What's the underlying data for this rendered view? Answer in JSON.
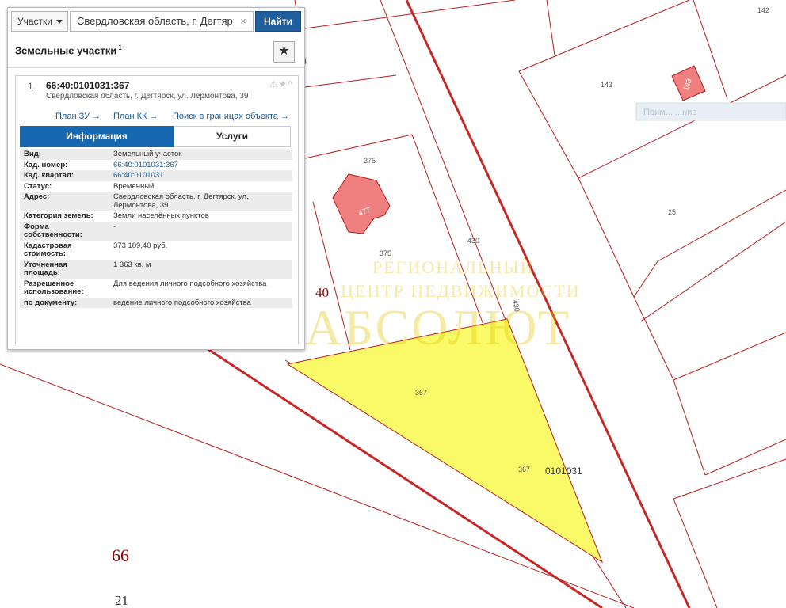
{
  "map": {
    "parcel_labels": [
      {
        "id": "142",
        "text": "142"
      },
      {
        "id": "143",
        "text": "143"
      },
      {
        "id": "143b",
        "text": "143"
      },
      {
        "id": "375a",
        "text": "375"
      },
      {
        "id": "375b",
        "text": "375"
      },
      {
        "id": "477",
        "text": "477"
      },
      {
        "id": "430a",
        "text": "430"
      },
      {
        "id": "430b",
        "text": "430"
      },
      {
        "id": "25",
        "text": "25"
      },
      {
        "id": "367a",
        "text": "367"
      },
      {
        "id": "367b",
        "text": "367"
      },
      {
        "id": "quarter",
        "text": "0101031"
      }
    ],
    "district_labels": {
      "d40": "40",
      "d66": "66",
      "d21": "21"
    },
    "ghost_chip": "Прим... ...ние",
    "watermark": {
      "line1": "РЕГИОНАЛЬНЫЙ",
      "line2": "ЦЕНТР НЕДВИЖИМОСТИ",
      "line3": "АБСОЛЮТ"
    },
    "colors": {
      "parcel_fill": "#fafa68",
      "building_fill": "#f08080",
      "boundary": "#b71c1c",
      "district_text": "#8b0000"
    }
  },
  "search": {
    "type_label": "Участки",
    "query": "Свердловская область, г. Дегтяр",
    "clear_icon": "×",
    "button_label": "Найти"
  },
  "results": {
    "title": "Земельные участки",
    "count": "1",
    "fav_icon": "★",
    "item": {
      "index": "1.",
      "number": "66:40:0101031:367",
      "icons": "⚠★^",
      "address": "Свердловская область, г. Дегтярск, ул. Лермонтова, 39",
      "links": {
        "plan_zu": "План ЗУ →",
        "plan_kk": "План КК →",
        "search_bounds": "Поиск в границах объекта →"
      },
      "tabs": {
        "info": "Информация",
        "services": "Услуги"
      },
      "rows": [
        {
          "k": "Вид:",
          "v": "Земельный участок"
        },
        {
          "k": "Кад. номер:",
          "v": "66:40:0101031:367"
        },
        {
          "k": "Кад. квартал:",
          "v": "66:40:0101031"
        },
        {
          "k": "Статус:",
          "v": "Временный"
        },
        {
          "k": "Адрес:",
          "v": "Свердловская область, г. Дегтярск, ул. Лермонтова, 39"
        },
        {
          "k": "Категория земель:",
          "v": "Земли населённых пунктов"
        },
        {
          "k": "Форма собственности:",
          "v": "-"
        },
        {
          "k": "Кадастровая стоимость:",
          "v": "373 189,40 руб."
        },
        {
          "k": "Уточненная площадь:",
          "v": "1 363 кв. м"
        },
        {
          "k": "Разрешенное использование:",
          "v": "Для ведения личного подсобного хозяйства"
        },
        {
          "k": "по документу:",
          "v": "ведение личного подсобного хозяйства"
        }
      ]
    }
  }
}
